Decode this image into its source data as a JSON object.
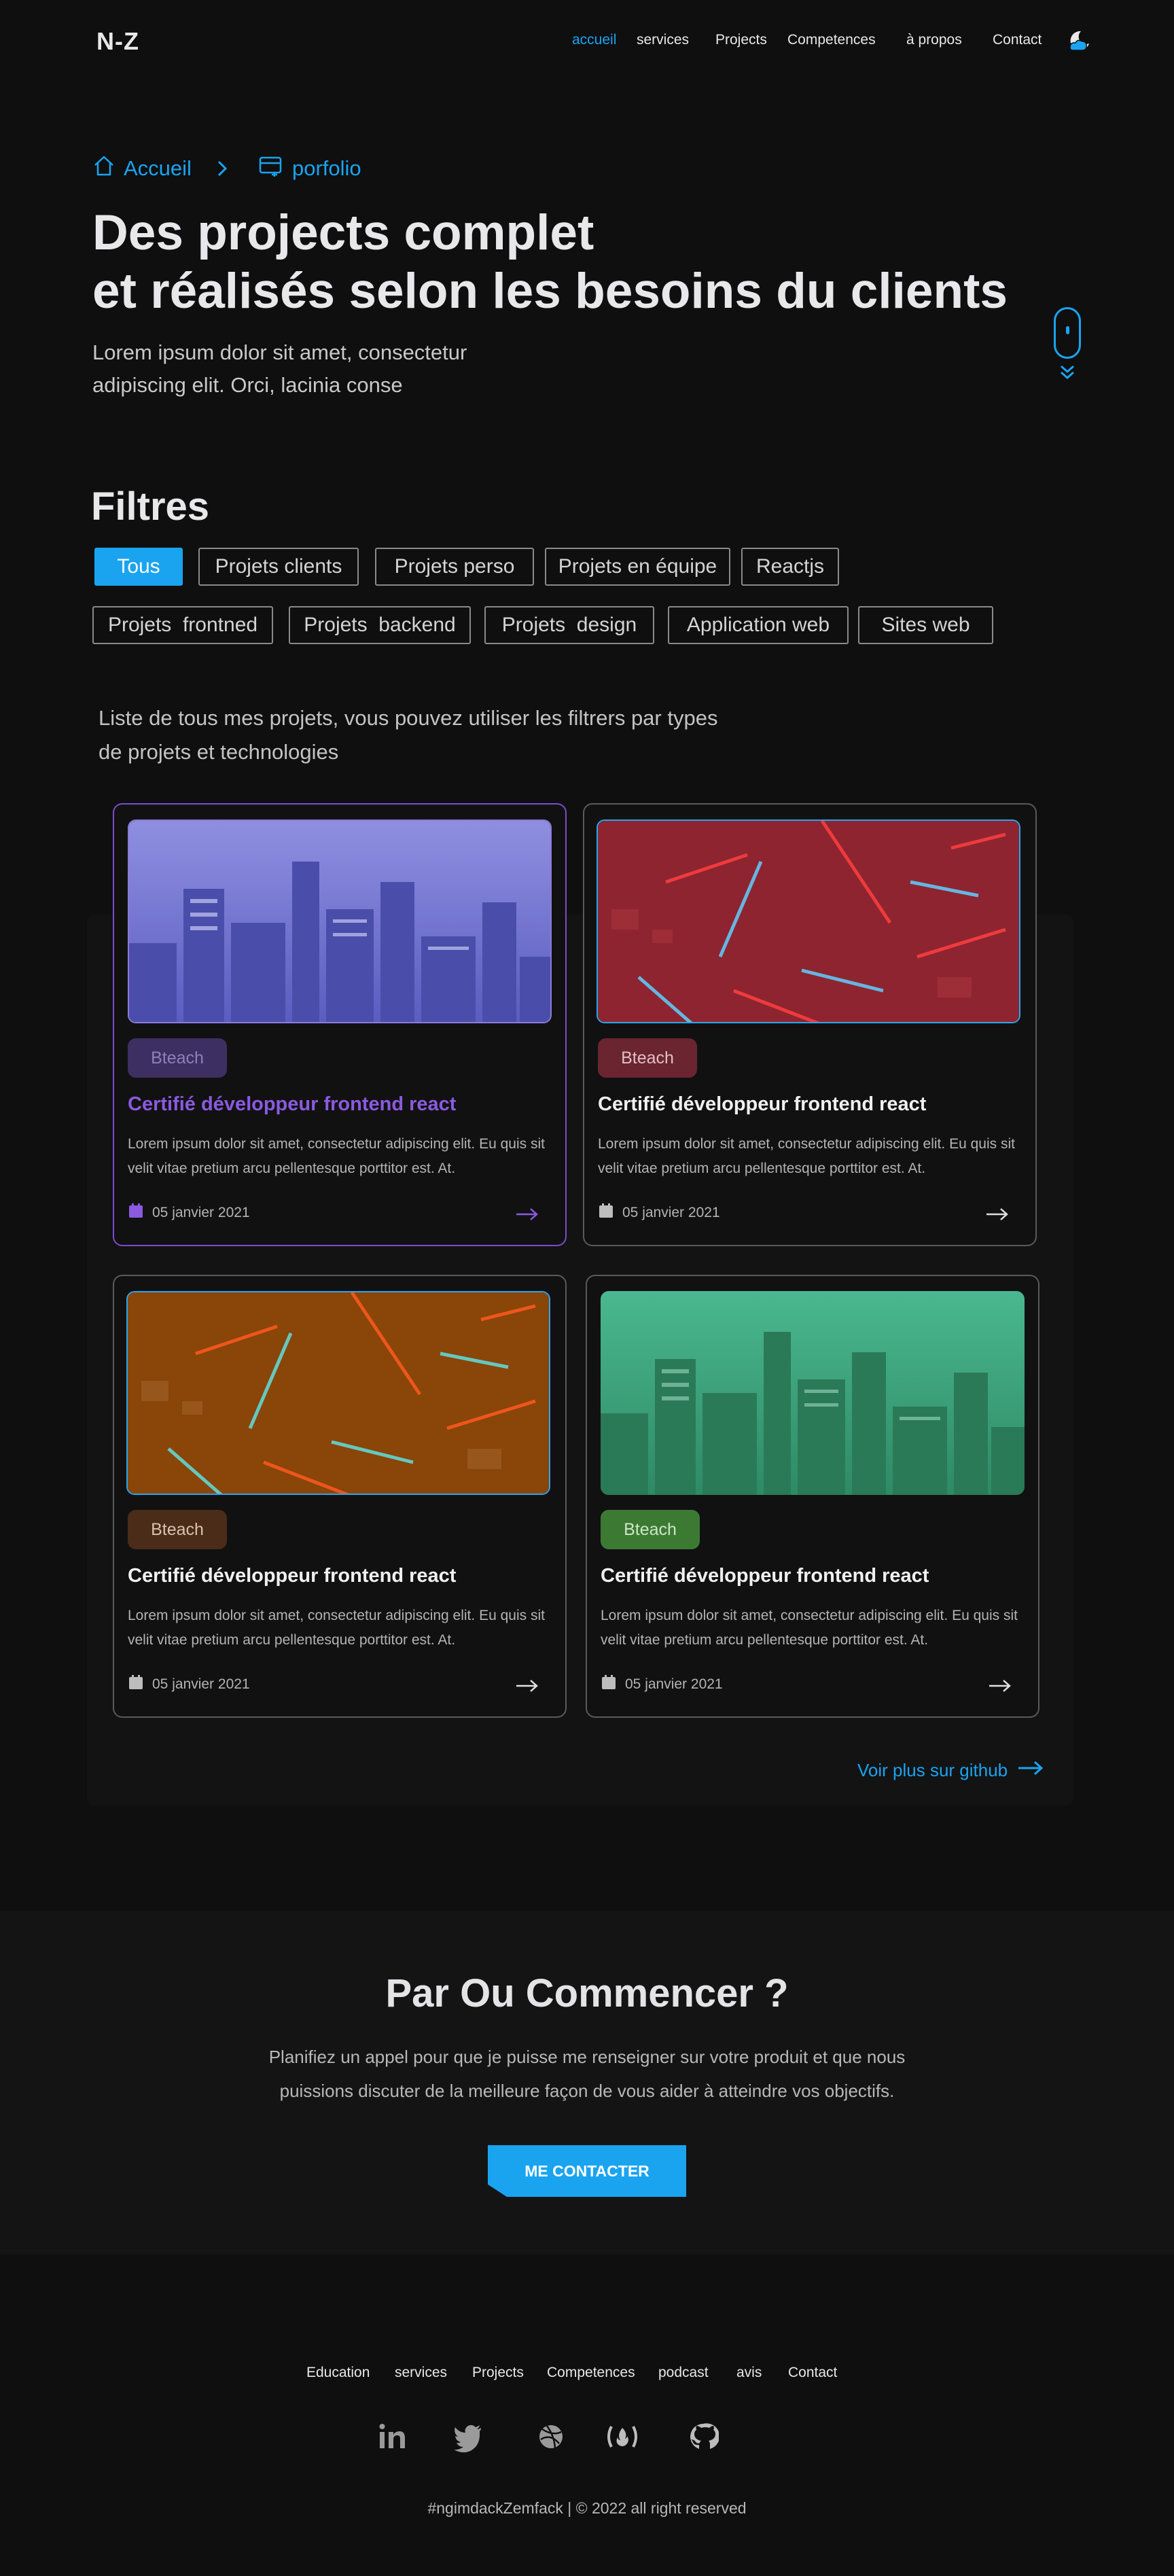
{
  "nav": {
    "logo": "N-Z",
    "links": [
      "accueil",
      "services",
      "Projects",
      "Competences",
      "à propos",
      "Contact"
    ],
    "theme_icon": "moon-cloud-icon"
  },
  "breadcrumb": {
    "home": "Accueil",
    "current": "porfolio"
  },
  "hero": {
    "title_line1": "Des projects complet",
    "title_line2": "et réalisés selon les besoins du clients",
    "subtitle": "Lorem ipsum dolor sit amet, consectetur adipiscing elit. Orci, lacinia conse"
  },
  "filters": {
    "title": "Filtres",
    "row1": [
      "Tous",
      "Projets clients",
      "Projets perso",
      "Projets en équipe",
      "Reactjs"
    ],
    "row2": [
      "Projets  frontned",
      "Projets  backend",
      "Projets  design",
      "Application web",
      "Sites web"
    ],
    "active": "Tous",
    "intro": "Liste de tous mes projets,  vous pouvez utiliser les filtrers par types de projets et technologies"
  },
  "cards": [
    {
      "badge": "Bteach",
      "title": "Certifié développeur frontend react",
      "text": "Lorem ipsum dolor sit amet, consectetur adipiscing elit. Eu quis sit velit vitae pretium arcu pellentesque porttitor est. At.",
      "date": "05 janvier 2021",
      "accent": "#8a5ae0"
    },
    {
      "badge": "Bteach",
      "title": "Certifié développeur frontend react",
      "text": "Lorem ipsum dolor sit amet, consectetur adipiscing elit. Eu quis sit velit vitae pretium arcu pellentesque porttitor est. At.",
      "date": "05 janvier 2021",
      "accent": "#ffffff"
    },
    {
      "badge": "Bteach",
      "title": "Certifié développeur frontend react",
      "text": "Lorem ipsum dolor sit amet, consectetur adipiscing elit. Eu quis sit velit vitae pretium arcu pellentesque porttitor est. At.",
      "date": "05 janvier 2021",
      "accent": "#ffffff"
    },
    {
      "badge": "Bteach",
      "title": "Certifié développeur frontend react",
      "text": "Lorem ipsum dolor sit amet, consectetur adipiscing elit. Eu quis sit velit vitae pretium arcu pellentesque porttitor est. At.",
      "date": "05 janvier 2021",
      "accent": "#ffffff"
    }
  ],
  "github_link": "Voir plus sur github",
  "cta": {
    "title": "Par Ou Commencer ?",
    "text": "Planifiez un appel pour que je puisse me renseigner sur votre produit et que nous puissions discuter de la meilleure façon de vous aider à atteindre vos objectifs.",
    "button": "ME CONTACTER"
  },
  "footer": {
    "links": [
      "Education",
      "services",
      "Projects",
      "Competences",
      "podcast",
      "avis",
      "Contact"
    ],
    "socials": [
      "linkedin-icon",
      "twitter-icon",
      "dribbble-icon",
      "freecodecamp-icon",
      "github-icon"
    ],
    "copyright": "#ngimdackZemfack | © 2022 all right reserved"
  },
  "colors": {
    "accent": "#1aa4f0",
    "background": "#0f0f10",
    "purple": "#8a5ae0"
  }
}
